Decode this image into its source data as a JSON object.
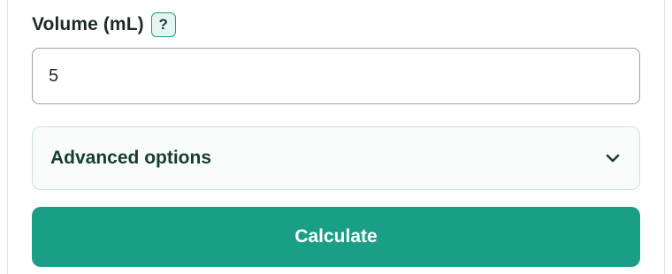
{
  "volume_field": {
    "label": "Volume (mL)",
    "help": "?",
    "value": "5"
  },
  "advanced": {
    "label": "Advanced options",
    "expanded": false,
    "toggle_icon": "chevron-down-icon"
  },
  "actions": {
    "calculate_label": "Calculate"
  },
  "colors": {
    "primary": "#1a9f86",
    "label_text": "#1f2a24",
    "advanced_bg": "#f7fcfa",
    "advanced_border": "#c9e2da",
    "help_bg": "#e6f5f1"
  }
}
